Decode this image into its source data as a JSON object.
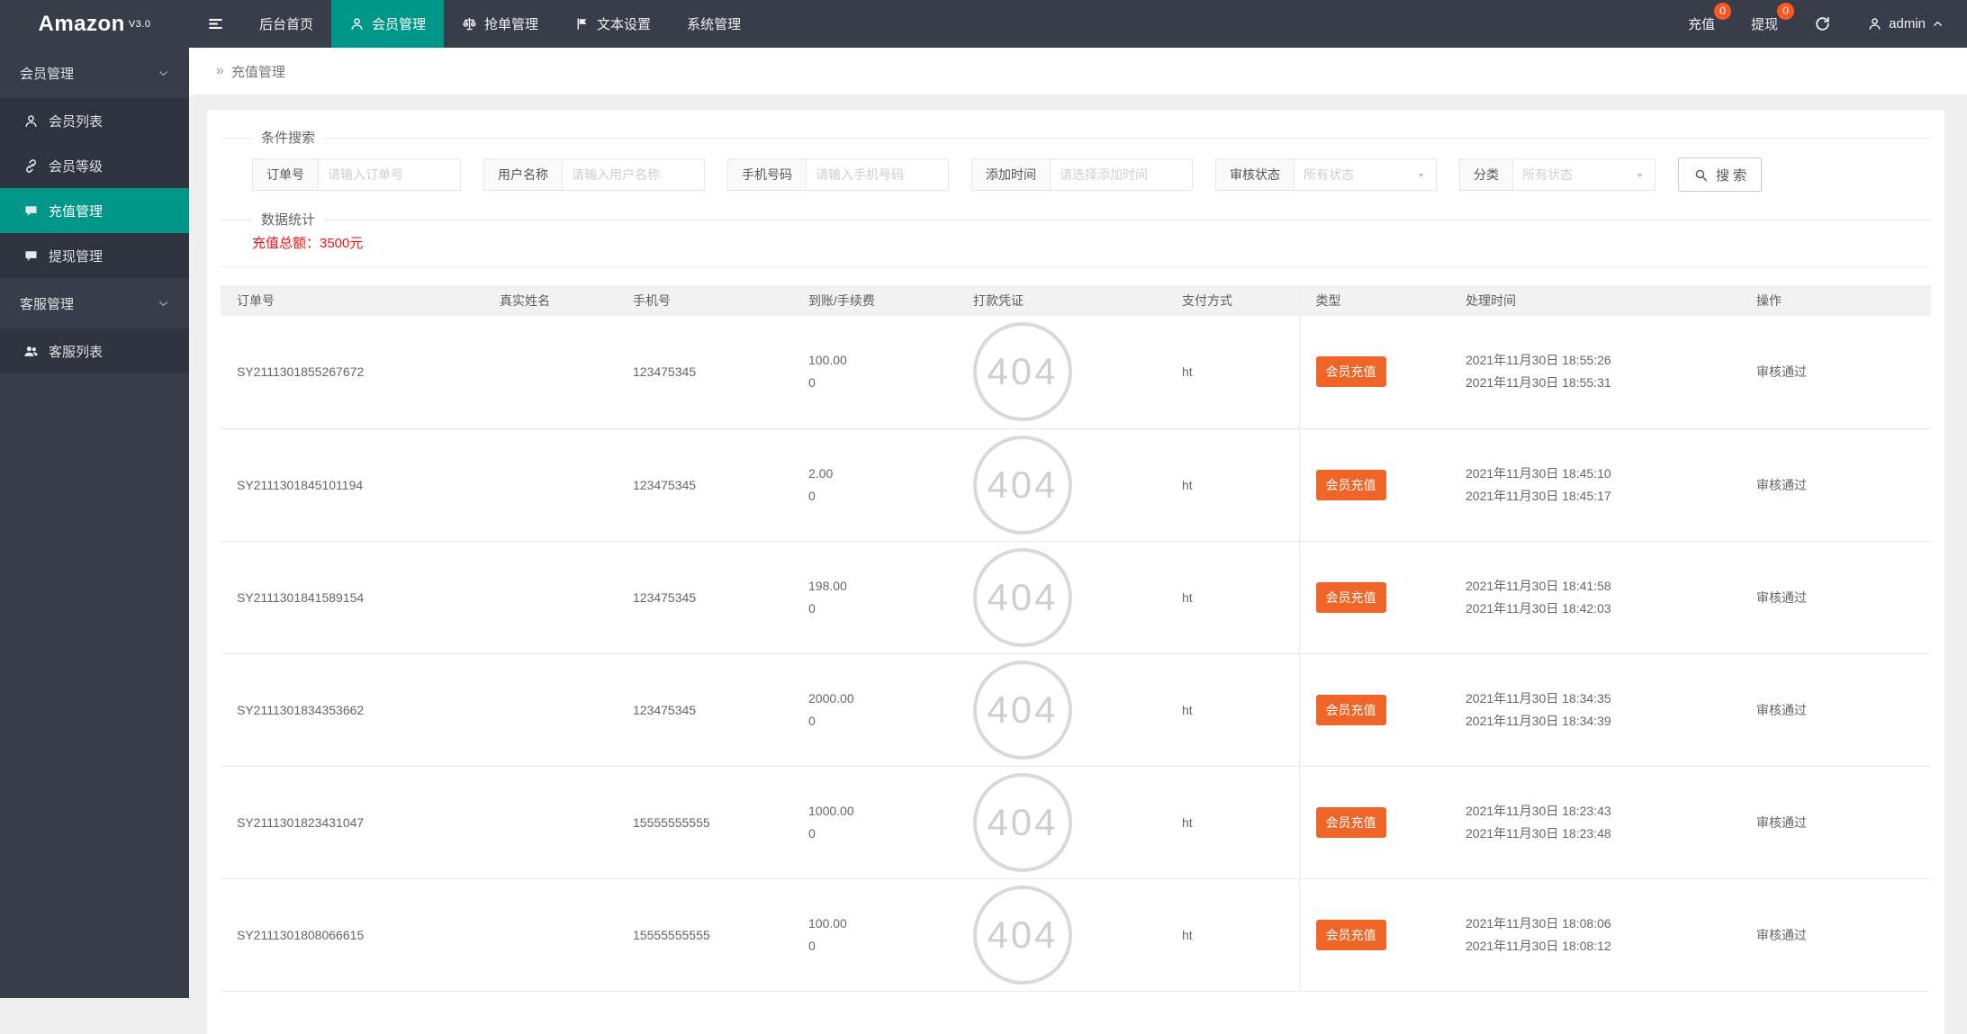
{
  "app": {
    "brand": "Amazon",
    "version": "V3.0"
  },
  "colors": {
    "theme_dark": "#393D49",
    "theme_teal": "#009688",
    "badge_red": "#FF5722",
    "type_badge_orange": "#EF6528",
    "total_red": "#f01414"
  },
  "header": {
    "nav": [
      {
        "label": "后台首页",
        "icon": null,
        "active": false
      },
      {
        "label": "会员管理",
        "icon": "user-icon",
        "active": true
      },
      {
        "label": "抢单管理",
        "icon": "scale-icon",
        "active": false
      },
      {
        "label": "文本设置",
        "icon": "flag-icon",
        "active": false
      },
      {
        "label": "系统管理",
        "icon": null,
        "active": false
      }
    ],
    "recharge_label": "充值",
    "recharge_badge": "0",
    "withdraw_label": "提现",
    "withdraw_badge": "0",
    "username": "admin"
  },
  "sidebar": {
    "sections": [
      {
        "title": "会员管理",
        "items": [
          {
            "label": "会员列表",
            "icon": "user-icon",
            "active": false
          },
          {
            "label": "会员等级",
            "icon": "link-icon",
            "active": false
          },
          {
            "label": "充值管理",
            "icon": "chat-icon",
            "active": true
          },
          {
            "label": "提现管理",
            "icon": "chat-icon",
            "active": false
          }
        ]
      },
      {
        "title": "客服管理",
        "items": [
          {
            "label": "客服列表",
            "icon": "users-icon",
            "active": false
          }
        ]
      }
    ]
  },
  "breadcrumb": {
    "separator": "»",
    "current": "充值管理"
  },
  "filters": {
    "legend": "条件搜索",
    "fields": [
      {
        "label": "订单号",
        "type": "text",
        "placeholder": "请输入订单号",
        "value": ""
      },
      {
        "label": "用户名称",
        "type": "text",
        "placeholder": "请输入用户名称",
        "value": ""
      },
      {
        "label": "手机号码",
        "type": "text",
        "placeholder": "请输入手机号码",
        "value": ""
      },
      {
        "label": "添加时间",
        "type": "text",
        "placeholder": "请选择添加时间",
        "value": ""
      },
      {
        "label": "审核状态",
        "type": "select",
        "value": "所有状态"
      },
      {
        "label": "分类",
        "type": "select",
        "value": "所有状态"
      }
    ],
    "search_label": "搜 索"
  },
  "stats": {
    "legend": "数据统计",
    "total_text": "充值总额：3500元"
  },
  "table": {
    "columns": [
      "订单号",
      "真实姓名",
      "手机号",
      "到账/手续费",
      "打款凭证",
      "支付方式",
      "类型",
      "处理时间",
      "操作"
    ],
    "rows": [
      {
        "order_no": "SY2111301855267672",
        "real_name": "",
        "phone": "123475345",
        "amount": "100.00",
        "fee": "0",
        "voucher": "404",
        "pay_method": "ht",
        "type": "会员充值",
        "time1": "2021年11月30日 18:55:26",
        "time2": "2021年11月30日 18:55:31",
        "action": "审核通过"
      },
      {
        "order_no": "SY2111301845101194",
        "real_name": "",
        "phone": "123475345",
        "amount": "2.00",
        "fee": "0",
        "voucher": "404",
        "pay_method": "ht",
        "type": "会员充值",
        "time1": "2021年11月30日 18:45:10",
        "time2": "2021年11月30日 18:45:17",
        "action": "审核通过"
      },
      {
        "order_no": "SY2111301841589154",
        "real_name": "",
        "phone": "123475345",
        "amount": "198.00",
        "fee": "0",
        "voucher": "404",
        "pay_method": "ht",
        "type": "会员充值",
        "time1": "2021年11月30日 18:41:58",
        "time2": "2021年11月30日 18:42:03",
        "action": "审核通过"
      },
      {
        "order_no": "SY2111301834353662",
        "real_name": "",
        "phone": "123475345",
        "amount": "2000.00",
        "fee": "0",
        "voucher": "404",
        "pay_method": "ht",
        "type": "会员充值",
        "time1": "2021年11月30日 18:34:35",
        "time2": "2021年11月30日 18:34:39",
        "action": "审核通过"
      },
      {
        "order_no": "SY2111301823431047",
        "real_name": "",
        "phone": "15555555555",
        "amount": "1000.00",
        "fee": "0",
        "voucher": "404",
        "pay_method": "ht",
        "type": "会员充值",
        "time1": "2021年11月30日 18:23:43",
        "time2": "2021年11月30日 18:23:48",
        "action": "审核通过"
      },
      {
        "order_no": "SY2111301808066615",
        "real_name": "",
        "phone": "15555555555",
        "amount": "100.00",
        "fee": "0",
        "voucher": "404",
        "pay_method": "ht",
        "type": "会员充值",
        "time1": "2021年11月30日 18:08:06",
        "time2": "2021年11月30日 18:08:12",
        "action": "审核通过"
      }
    ]
  }
}
